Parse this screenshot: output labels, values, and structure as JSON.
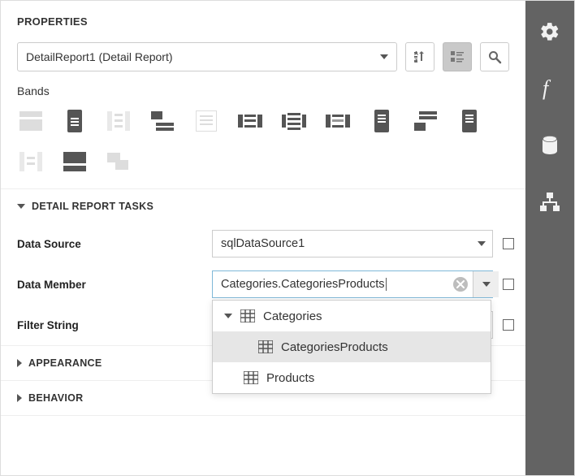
{
  "panel_title": "PROPERTIES",
  "component_selector": "DetailReport1 (Detail Report)",
  "bands_label": "Bands",
  "band_icons": [
    {
      "name": "band-1",
      "dark": false
    },
    {
      "name": "band-2",
      "dark": true
    },
    {
      "name": "band-3",
      "dark": false
    },
    {
      "name": "band-4",
      "dark": true
    },
    {
      "name": "band-5",
      "dark": false
    },
    {
      "name": "band-6",
      "dark": true
    },
    {
      "name": "band-7",
      "dark": true
    },
    {
      "name": "band-8",
      "dark": true
    },
    {
      "name": "band-9",
      "dark": true
    },
    {
      "name": "band-10",
      "dark": true
    },
    {
      "name": "band-11",
      "dark": true
    },
    {
      "name": "band-12",
      "dark": false
    },
    {
      "name": "band-13",
      "dark": true
    },
    {
      "name": "band-14",
      "dark": false
    }
  ],
  "sections": {
    "tasks": {
      "title": "DETAIL REPORT TASKS",
      "data_source": {
        "label": "Data Source",
        "value": "sqlDataSource1"
      },
      "data_member": {
        "label": "Data Member",
        "value": "Categories.CategoriesProducts"
      },
      "filter_string": {
        "label": "Filter String",
        "value": ""
      }
    },
    "appearance": {
      "title": "APPEARANCE"
    },
    "behavior": {
      "title": "BEHAVIOR"
    }
  },
  "tree": {
    "root": "Categories",
    "child_sel": "CategoriesProducts",
    "sibling": "Products"
  },
  "sidebar": [
    {
      "name": "settings",
      "icon": "gear"
    },
    {
      "name": "expressions",
      "icon": "fx"
    },
    {
      "name": "datasources",
      "icon": "db"
    },
    {
      "name": "explorer",
      "icon": "tree"
    }
  ]
}
